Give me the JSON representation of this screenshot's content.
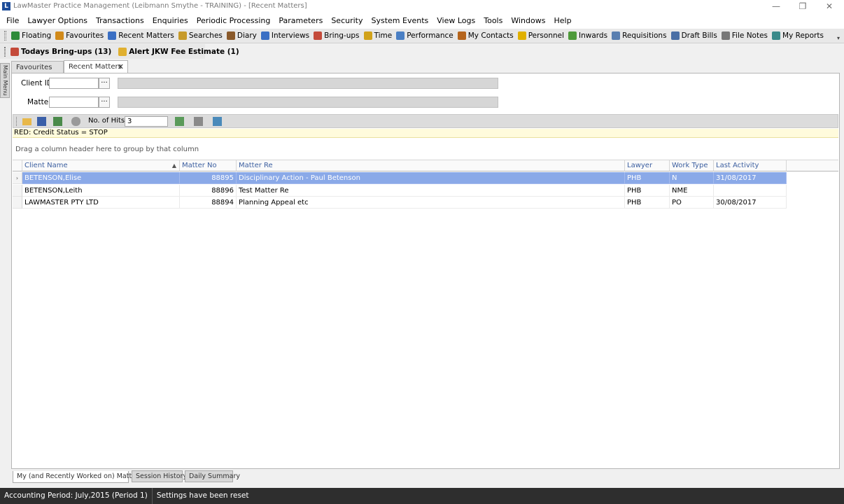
{
  "window": {
    "title": "LawMaster Practice Management (Leibmann Smythe - TRAINING) - [Recent Matters]",
    "app_icon_letter": "L"
  },
  "menubar": [
    "File",
    "Lawyer Options",
    "Transactions",
    "Enquiries",
    "Periodic Processing",
    "Parameters",
    "Security",
    "System Events",
    "View Logs",
    "Tools",
    "Windows",
    "Help"
  ],
  "toolbar": [
    {
      "label": "Floating",
      "icon": "floating-icon",
      "color": "#2e8b3a"
    },
    {
      "label": "Favourites",
      "icon": "favourites-icon",
      "color": "#d18a1a"
    },
    {
      "label": "Recent Matters",
      "icon": "recent-matters-icon",
      "color": "#3a6fc4"
    },
    {
      "label": "Searches",
      "icon": "searches-icon",
      "color": "#c79a2a"
    },
    {
      "label": "Diary",
      "icon": "diary-icon",
      "color": "#8a5a2b"
    },
    {
      "label": "Interviews",
      "icon": "interviews-icon",
      "color": "#3a6fc4"
    },
    {
      "label": "Bring-ups",
      "icon": "bring-ups-icon",
      "color": "#c44a3a"
    },
    {
      "label": "Time",
      "icon": "time-icon",
      "color": "#d1a21a"
    },
    {
      "label": "Performance",
      "icon": "performance-icon",
      "color": "#4a7fc4"
    },
    {
      "label": "My Contacts",
      "icon": "contacts-icon",
      "color": "#b5651d"
    },
    {
      "label": "Personnel",
      "icon": "personnel-icon",
      "color": "#e0b000"
    },
    {
      "label": "Inwards",
      "icon": "inwards-icon",
      "color": "#4e9a3a"
    },
    {
      "label": "Requisitions",
      "icon": "requisitions-icon",
      "color": "#5a7fb0"
    },
    {
      "label": "Draft Bills",
      "icon": "draft-bills-icon",
      "color": "#4a6fa5"
    },
    {
      "label": "File Notes",
      "icon": "file-notes-icon",
      "color": "#777777"
    },
    {
      "label": "My Reports",
      "icon": "reports-icon",
      "color": "#3a8a8a"
    }
  ],
  "toolbar2": {
    "bringups": "Todays Bring-ups (13)",
    "alert": "Alert JKW Fee Estimate (1)"
  },
  "sidetab": "Main Menu",
  "doctabs": {
    "favourites": "Favourites",
    "recent": "Recent Matters",
    "close": "✕"
  },
  "filters": {
    "client_label": "Client ID:",
    "matter_label": "Matter:",
    "client_value": "",
    "matter_value": "",
    "ellipsis": "···"
  },
  "gridtools": {
    "hits_label": "No. of Hits",
    "hits_value": "3"
  },
  "redbar": "RED: Credit Status = STOP",
  "grouphint": "Drag a column header here to group by that column",
  "grid": {
    "columns": [
      "Client Name",
      "Matter No",
      "Matter Re",
      "Lawyer",
      "Work Type",
      "Last Activity"
    ],
    "sort_glyph": "▲",
    "rows": [
      {
        "client": "BETENSON,Elise",
        "matter_no": "88895",
        "matter_re": "Disciplinary Action - Paul Betenson",
        "lawyer": "PHB",
        "work_type": "N",
        "last_activity": "31/08/2017",
        "selected": true
      },
      {
        "client": "BETENSON,Leith",
        "matter_no": "88896",
        "matter_re": "Test Matter Re",
        "lawyer": "PHB",
        "work_type": "NME",
        "last_activity": "",
        "selected": false
      },
      {
        "client": "LAWMASTER PTY LTD",
        "matter_no": "88894",
        "matter_re": "Planning Appeal etc",
        "lawyer": "PHB",
        "work_type": "PO",
        "last_activity": "30/08/2017",
        "selected": false
      }
    ],
    "current_row_glyph": "›"
  },
  "bottomtabs": [
    "My (and Recently Worked on) Matters",
    "Session History",
    "Daily Summary"
  ],
  "status": [
    "Accounting Period: July,2015 (Period 1)",
    "Settings have been reset"
  ]
}
